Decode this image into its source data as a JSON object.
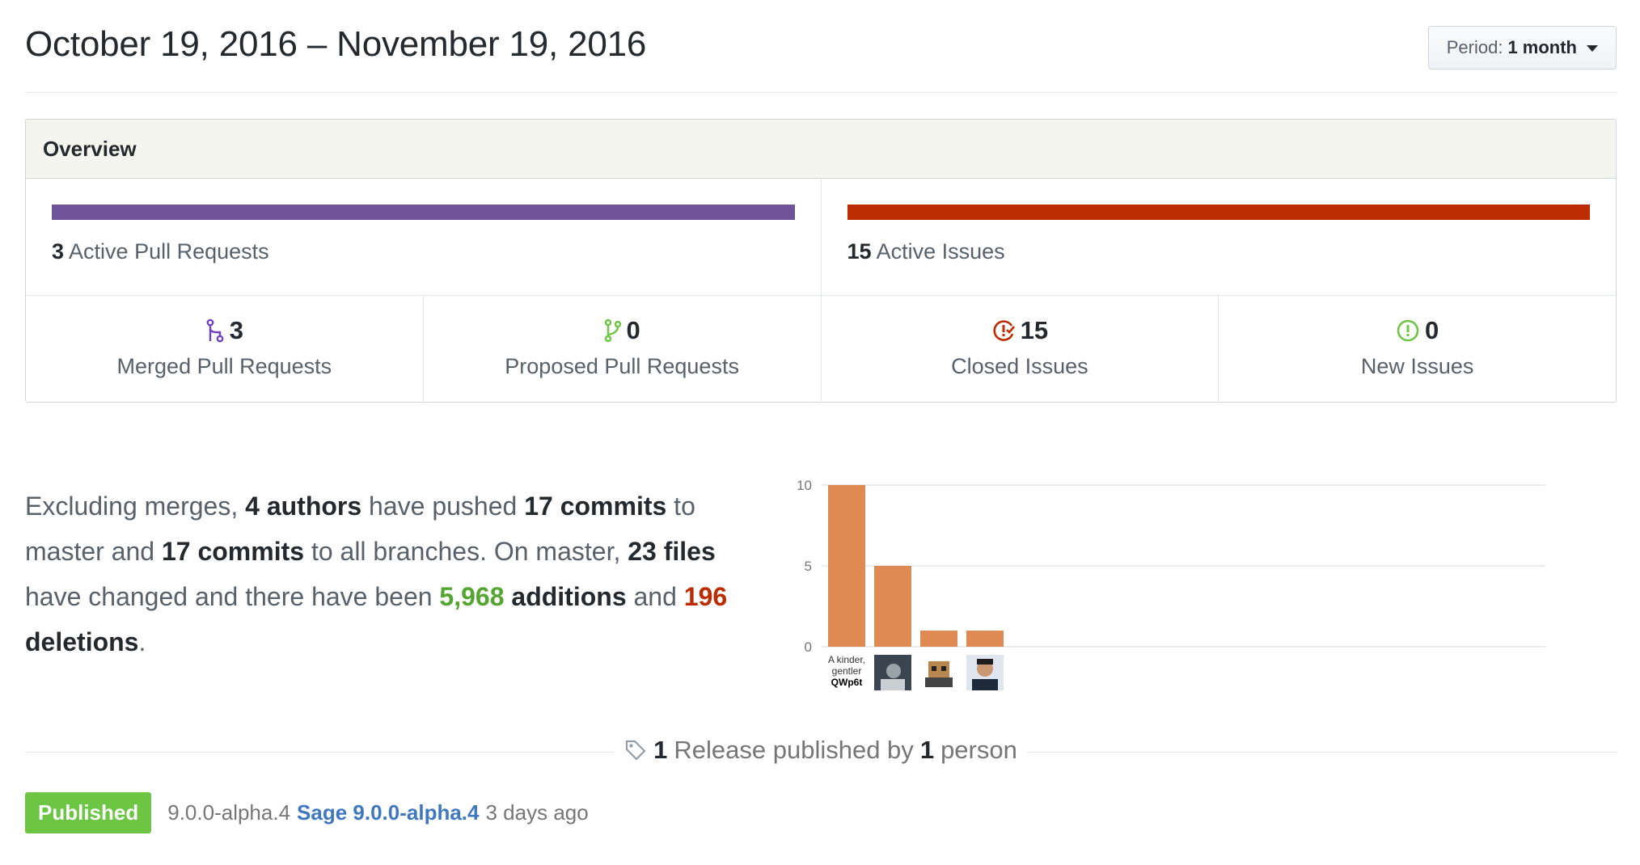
{
  "header": {
    "title": "October 19, 2016 – November 19, 2016",
    "period_label": "Period:",
    "period_value": "1 month"
  },
  "overview": {
    "heading": "Overview",
    "active_prs": {
      "count": "3",
      "label": "Active Pull Requests",
      "color": "#6f5499"
    },
    "active_issues": {
      "count": "15",
      "label": "Active Issues",
      "color": "#bd2c00"
    },
    "stats": [
      {
        "icon": "merged-pr-icon",
        "value": "3",
        "label": "Merged Pull Requests",
        "icon_color": "#6f42c1"
      },
      {
        "icon": "proposed-pr-icon",
        "value": "0",
        "label": "Proposed Pull Requests",
        "icon_color": "#6cc644"
      },
      {
        "icon": "closed-issue-icon",
        "value": "15",
        "label": "Closed Issues",
        "icon_color": "#bd2c00"
      },
      {
        "icon": "new-issue-icon",
        "value": "0",
        "label": "New Issues",
        "icon_color": "#6cc644"
      }
    ]
  },
  "summary": {
    "t1": "Excluding merges,",
    "authors": "4 authors",
    "t2": "have pushed",
    "commits_master": "17 commits",
    "t3": "to master and",
    "commits_all": "17 commits",
    "t4": "to all branches. On master,",
    "files": "23 files",
    "t5": "have changed and there have been",
    "additions_num": "5,968",
    "additions_word": "additions",
    "t6": "and",
    "deletions_num": "196",
    "deletions_word": "deletions",
    "t7": "."
  },
  "chart_data": {
    "type": "bar",
    "categories": [
      "A kinder, gentler QWp6t",
      "avatar 2",
      "avatar 3",
      "avatar 4"
    ],
    "values": [
      10,
      5,
      1,
      1
    ],
    "yticks": [
      0,
      5,
      10
    ],
    "ylim": [
      0,
      10
    ],
    "bar_color": "#de8a52",
    "first_label_lines": [
      "A kinder,",
      "gentler",
      "QWp6t"
    ]
  },
  "releases": {
    "count": "1",
    "t1": "Release published by",
    "people": "1",
    "t2": "person",
    "items": [
      {
        "status": "Published",
        "tag": "9.0.0-alpha.4",
        "name": "Sage 9.0.0-alpha.4",
        "time": "3 days ago"
      }
    ]
  }
}
